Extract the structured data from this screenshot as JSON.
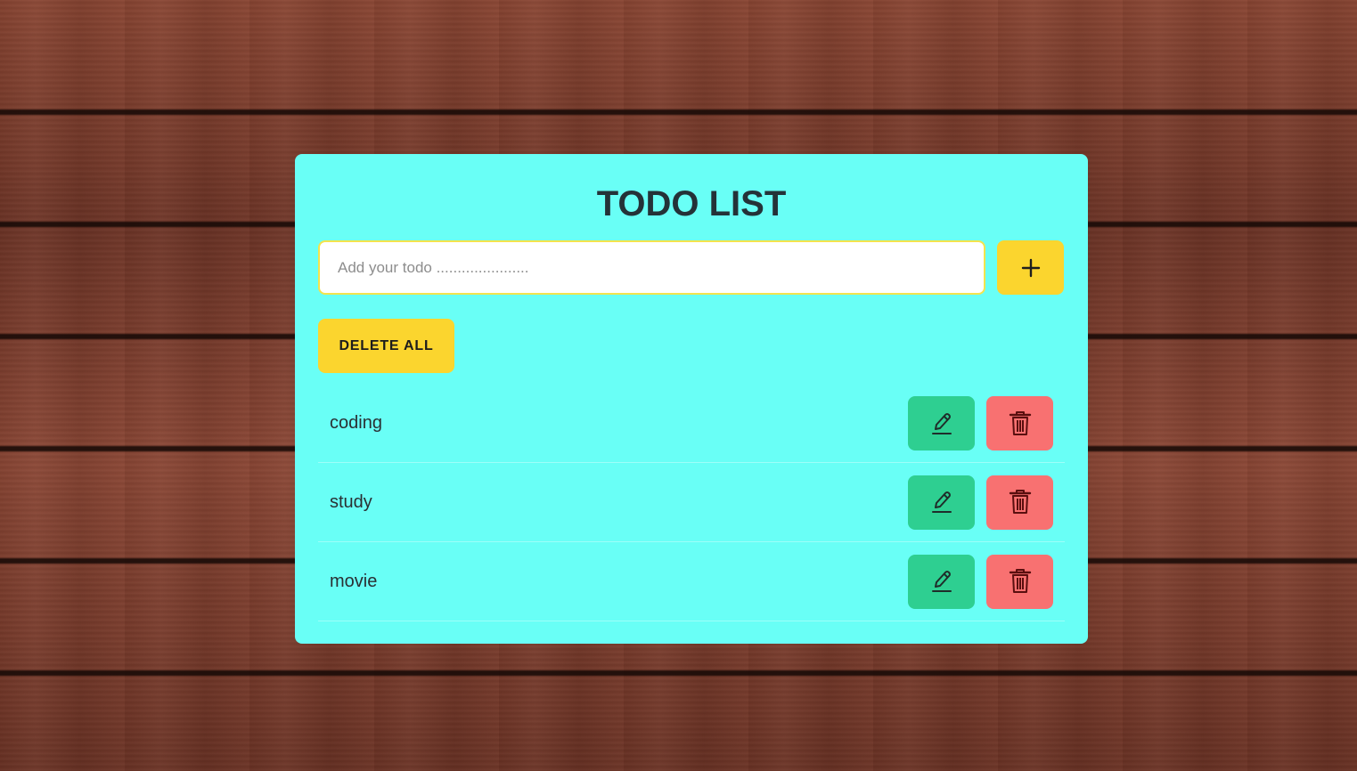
{
  "app": {
    "title": "TODO LIST"
  },
  "input": {
    "placeholder": "Add your todo ......................",
    "value": ""
  },
  "add_button": {
    "icon": "plus-icon"
  },
  "delete_all_label": "DELETE ALL",
  "todos": [
    {
      "text": "coding"
    },
    {
      "text": "study"
    },
    {
      "text": "movie"
    }
  ],
  "colors": {
    "card_bg": "#69fff6",
    "accent_yellow": "#fbd52e",
    "edit_green": "#2ecf91",
    "delete_red": "#f87171"
  },
  "icons": {
    "edit": "pencil-icon",
    "delete": "trash-icon"
  }
}
